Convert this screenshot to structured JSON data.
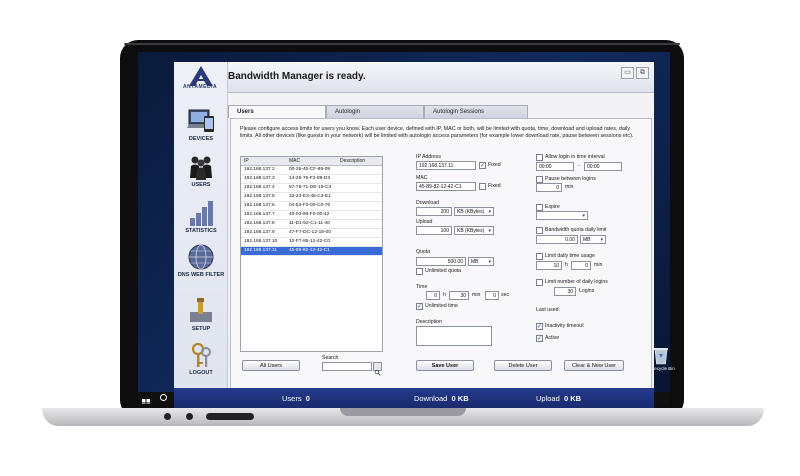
{
  "app": {
    "status": "Bandwidth Manager is ready.",
    "logo_text": "ANTAMEDIA"
  },
  "nav": {
    "items": [
      {
        "label": "DEVICES",
        "icon": "devices-icon"
      },
      {
        "label": "USERS",
        "icon": "users-icon"
      },
      {
        "label": "STATISTICS",
        "icon": "statistics-icon"
      },
      {
        "label": "DNS WEB FILTER",
        "icon": "globe-icon"
      },
      {
        "label": "SETUP",
        "icon": "setup-icon"
      },
      {
        "label": "LOGOUT",
        "icon": "keys-icon"
      }
    ]
  },
  "tabs": [
    {
      "label": "Users",
      "active": true
    },
    {
      "label": "Autologin",
      "active": false
    },
    {
      "label": "Autologin Sessions",
      "active": false
    }
  ],
  "instructions": "Please configure access limits for users you know. Each user device, defined with IP, MAC or both, will be limited with quota, time, download and upload rates, daily limits. All other devices (like guests in your network) will be limited with autologin access parameters (for example lower download rate, pause between sessions etc).",
  "table": {
    "columns": [
      "IP",
      "MAC",
      "Description"
    ],
    "rows": [
      [
        "192.168.137.2",
        "00-26-45-CF-89-09",
        ""
      ],
      [
        "192.168.137.3",
        "14-26-75-F2-89-D3",
        ""
      ],
      [
        "192.168.137.4",
        "57-78-71-DE-19-C3",
        ""
      ],
      [
        "192.168.137.5",
        "32-23-E3-45-C3-E1",
        ""
      ],
      [
        "192.168.137.6",
        "04-53-F3-00-C0-76",
        ""
      ],
      [
        "192.168.137.7",
        "40-03-99-F0-00-42",
        ""
      ],
      [
        "192.168.137.8",
        "11-D1-52-C1-11-40",
        ""
      ],
      [
        "192.168.137.9",
        "47-F7-DC-12-18-00",
        ""
      ],
      [
        "192.168.137.10",
        "12-F7-85-12-42-C0",
        ""
      ],
      [
        "192.168.137.11",
        "45-89-82-12-42-C1",
        ""
      ]
    ],
    "selected_index": 9
  },
  "search": {
    "label": "Search",
    "value": ""
  },
  "buttons": {
    "all_users": "All Users",
    "save_user": "Save User",
    "delete_user": "Delete User",
    "clear_new_user": "Clear & New User"
  },
  "form": {
    "ip_label": "IP Address",
    "ip_value": "192.168.137.11",
    "ip_fixed": "Fixed",
    "mac_label": "MAC",
    "mac_value": "45-89-82-12-42-C1",
    "mac_fixed": "Fixed",
    "download_label": "Download",
    "download_value": "200",
    "download_unit": "KB (KBytes)",
    "upload_label": "Upload",
    "upload_value": "100",
    "upload_unit": "KB (KBytes)",
    "quota_label": "Quota",
    "quota_value": "500.00",
    "quota_unit": "MB",
    "unlimited_quota": "Unlimited quota",
    "time_label": "Time",
    "time_h_value": "0",
    "time_h_unit": "h",
    "time_min_value": "30",
    "time_min_unit": "min",
    "time_sec_value": "0",
    "time_sec_unit": "sec",
    "unlimited_time": "Unlimited time",
    "description_label": "Description",
    "description_value": ""
  },
  "right_form": {
    "allow_login": "Allow login in time interval",
    "from_time": "00:00",
    "dash": "-",
    "to_time": "00:00",
    "pause_label": "Pause between logins",
    "pause_value": "0",
    "pause_unit": "min",
    "expire_label": "Expire",
    "expire_value": "",
    "bw_quota_label": "Bandwidth quota daily limit",
    "bw_quota_value": "0.00",
    "bw_quota_unit": "MB",
    "time_usage_label": "Limit daily time usage",
    "time_usage_h": "10",
    "time_usage_h_unit": "h",
    "time_usage_min": "0",
    "time_usage_min_unit": "min",
    "daily_logins_label": "Limit number of daily logins",
    "daily_logins_value": "30",
    "daily_logins_unit": "Logins",
    "last_used": "Last used:",
    "inactivity_timeout": "Inactivity timeout",
    "active": "Active"
  },
  "footer": {
    "users_label": "Users",
    "users_value": "0",
    "download_label": "Download",
    "download_value": "0 KB",
    "upload_label": "Upload",
    "upload_value": "0 KB"
  },
  "desktop": {
    "recycle_label": "Recycle Bin"
  },
  "colors": {
    "footer_blue": "#1a2a6e",
    "selection_blue": "#3a6ad6"
  }
}
